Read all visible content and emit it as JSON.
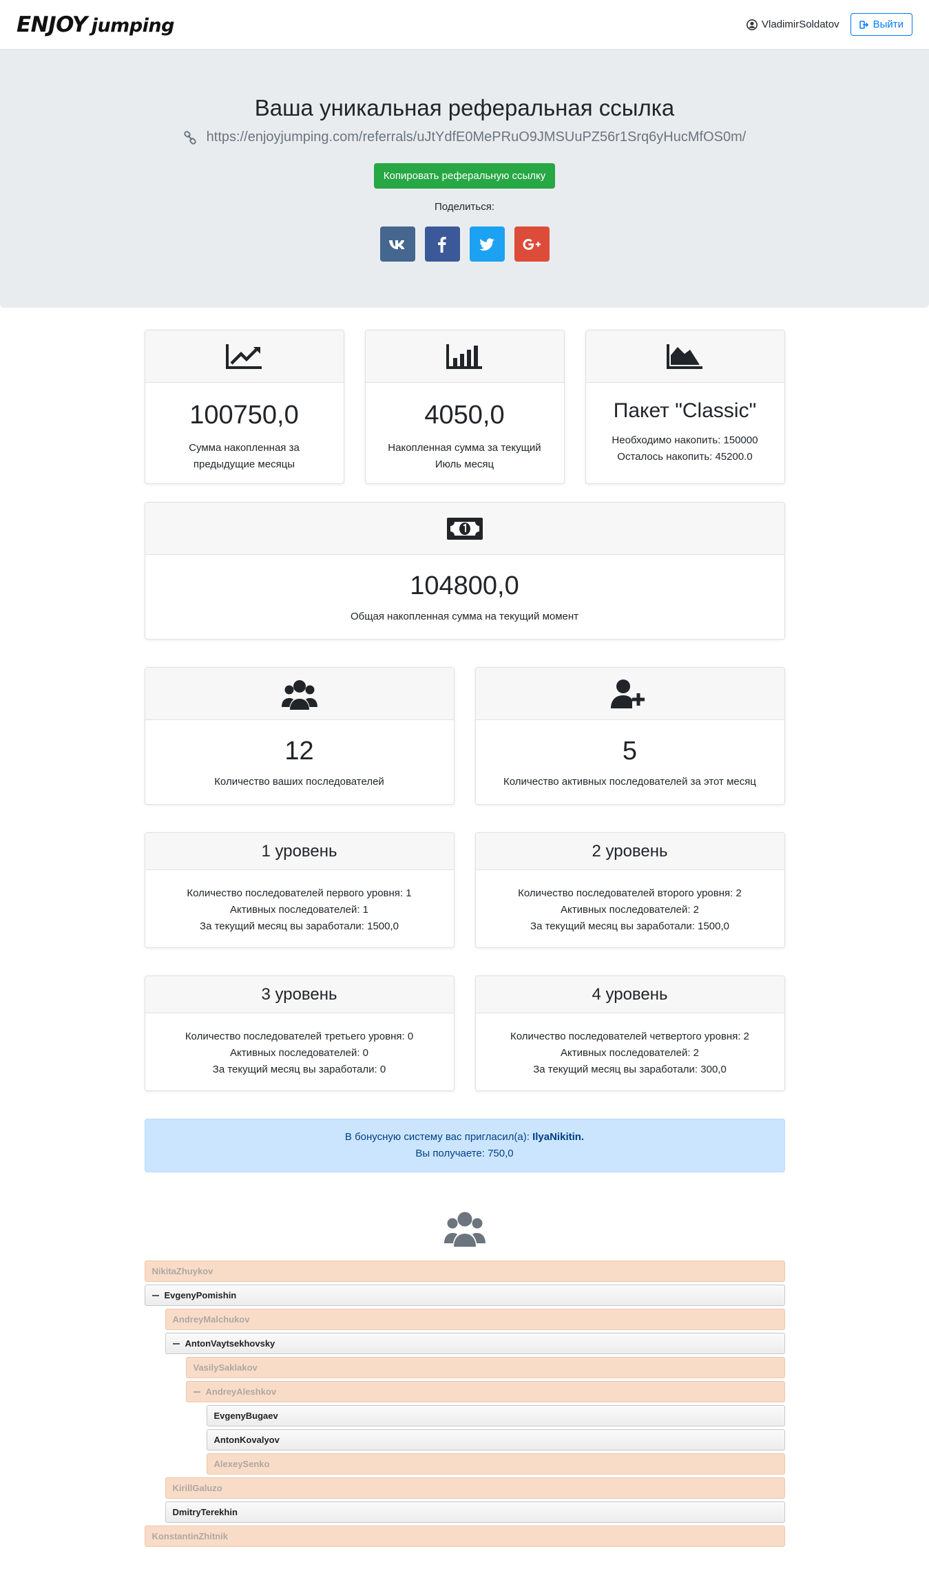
{
  "brand": {
    "logo_main": "ENJOY",
    "logo_sub": "jumping"
  },
  "header": {
    "username": "VladimirSoldatov",
    "logout_label": "Выйти"
  },
  "hero": {
    "title": "Ваша уникальная реферальная ссылка",
    "link": "https://enjoyjumping.com/referrals/uJtYdfE0MePRuO9JMSUuPZ56r1Srq6yHucMfOS0m/",
    "copy_label": "Копировать реферальную ссылку",
    "share_label": "Поделиться:",
    "socials": [
      {
        "name": "vk",
        "color": "#45668e"
      },
      {
        "name": "facebook",
        "color": "#3b5998"
      },
      {
        "name": "twitter",
        "color": "#1da1f2"
      },
      {
        "name": "google-plus",
        "color": "#dd4b39"
      }
    ]
  },
  "stats": {
    "prev_months": {
      "value": "100750,0",
      "desc1": "Сумма накопленная за",
      "desc2": "предыдущие месяцы"
    },
    "current_month": {
      "value": "4050,0",
      "desc1": "Накопленная сумма за текущий",
      "desc2": "Июль месяц"
    },
    "package": {
      "title": "Пакет \"Classic\"",
      "need": "Необходимо накопить: 150000",
      "left": "Осталось накопить: 45200.0"
    },
    "total": {
      "value": "104800,0",
      "desc": "Общая накопленная сумма на текущий момент"
    }
  },
  "followers": {
    "total": {
      "value": "12",
      "desc": "Количество ваших последователей"
    },
    "active": {
      "value": "5",
      "desc": "Количество активных последователей за этот месяц"
    }
  },
  "levels": [
    {
      "title": "1 уровень",
      "l1": "Количество последователей первого уровня: 1",
      "l2": "Активных последователей: 1",
      "l3": "За текущий месяц вы заработали: 1500,0"
    },
    {
      "title": "2 уровень",
      "l1": "Количество последователей второго уровня: 2",
      "l2": "Активных последователей: 2",
      "l3": "За текущий месяц вы заработали: 1500,0"
    },
    {
      "title": "3 уровень",
      "l1": "Количество последователей третьего уровня: 0",
      "l2": "Активных последователей: 0",
      "l3": "За текущий месяц вы заработали: 0"
    },
    {
      "title": "4 уровень",
      "l1": "Количество последователей четвертого уровня: 2",
      "l2": "Активных последователей: 2",
      "l3": "За текущий месяц вы заработали: 300,0"
    }
  ],
  "invite": {
    "text": "В бонусную систему вас пригласил(а):",
    "inviter": "IlyaNikitin.",
    "receive": "Вы получаете: 750,0"
  },
  "tree": [
    {
      "name": "NikitaZhuykov",
      "depth": 0,
      "active": false,
      "expanded": false
    },
    {
      "name": "EvgenyPomishin",
      "depth": 0,
      "active": true,
      "expanded": true
    },
    {
      "name": "AndreyMalchukov",
      "depth": 1,
      "active": false,
      "expanded": false
    },
    {
      "name": "AntonVaytsekhovsky",
      "depth": 1,
      "active": true,
      "expanded": true
    },
    {
      "name": "VasilySaklakov",
      "depth": 2,
      "active": false,
      "expanded": false
    },
    {
      "name": "AndreyAleshkov",
      "depth": 2,
      "active": false,
      "expanded": true
    },
    {
      "name": "EvgenyBugaev",
      "depth": 3,
      "active": true,
      "expanded": false
    },
    {
      "name": "AntonKovalyov",
      "depth": 3,
      "active": true,
      "expanded": false
    },
    {
      "name": "AlexeySenko",
      "depth": 3,
      "active": false,
      "expanded": false
    },
    {
      "name": "KirillGaluzo",
      "depth": 1,
      "active": false,
      "expanded": false
    },
    {
      "name": "DmitryTerekhin",
      "depth": 1,
      "active": true,
      "expanded": false
    },
    {
      "name": "KonstantinZhitnik",
      "depth": 0,
      "active": false,
      "expanded": false
    }
  ]
}
